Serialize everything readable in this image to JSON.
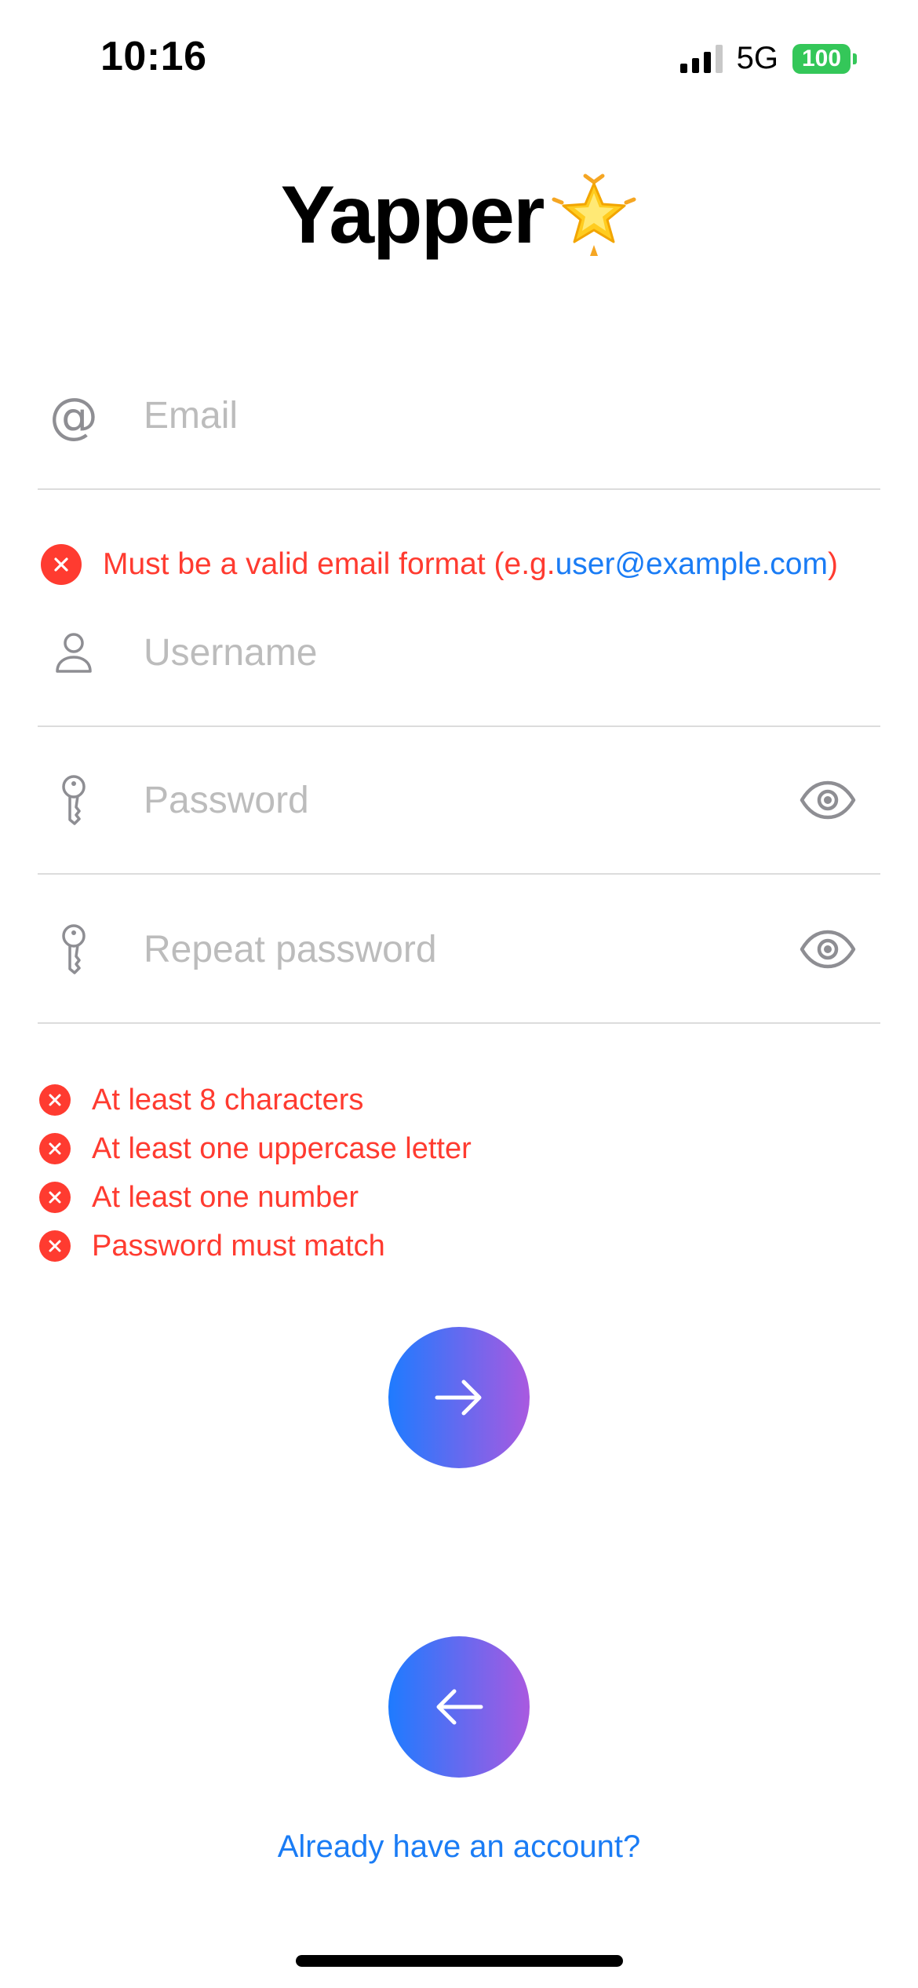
{
  "status_bar": {
    "time": "10:16",
    "network": "5G",
    "battery": "100"
  },
  "logo": {
    "text": "Yapper",
    "emoji": "🌟"
  },
  "fields": {
    "email": {
      "placeholder": "Email",
      "value": ""
    },
    "username": {
      "placeholder": "Username",
      "value": ""
    },
    "password": {
      "placeholder": "Password",
      "value": ""
    },
    "repeat_password": {
      "placeholder": "Repeat password",
      "value": ""
    }
  },
  "email_error": {
    "prefix": "Must be a valid email format (e.g. ",
    "example": "user@example.com",
    "suffix": ")"
  },
  "password_requirements": [
    "At least 8 characters",
    "At least one uppercase letter",
    "At least one number",
    "Password must match"
  ],
  "signin_link": "Already have an account?",
  "colors": {
    "error": "#ff3b30",
    "link": "#1a7cf5",
    "gradient_start": "#1e7bff",
    "gradient_end": "#a959e0",
    "battery": "#34c759"
  }
}
